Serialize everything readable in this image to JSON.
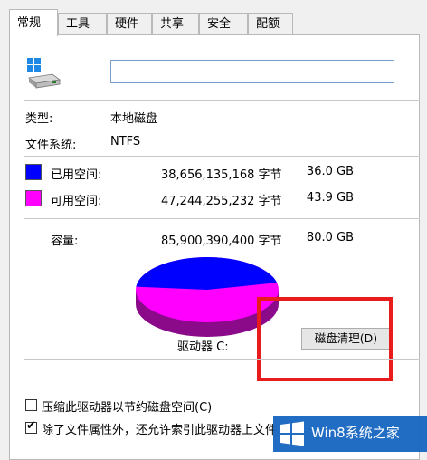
{
  "tabs": [
    {
      "label": "常规"
    },
    {
      "label": "工具"
    },
    {
      "label": "硬件"
    },
    {
      "label": "共享"
    },
    {
      "label": "安全"
    },
    {
      "label": "配额"
    }
  ],
  "volume_name_value": "",
  "rows": {
    "type_label": "类型:",
    "type_value": "本地磁盘",
    "fs_label": "文件系统:",
    "fs_value": "NTFS",
    "used_label": "已用空间:",
    "used_bytes": "38,656,135,168 字节",
    "used_gb": "36.0 GB",
    "free_label": "可用空间:",
    "free_bytes": "47,244,255,232 字节",
    "free_gb": "43.9 GB",
    "capacity_label": "容量:",
    "capacity_bytes": "85,900,390,400 字节",
    "capacity_gb": "80.0 GB"
  },
  "drive_label": "驱动器 C:",
  "cleanup_button": "磁盘清理(D)",
  "checkboxes": [
    {
      "label": "压缩此驱动器以节约磁盘空间(C)",
      "checked": false
    },
    {
      "label": "除了文件属性外，还允许索引此驱动器上文件",
      "checked": true
    }
  ],
  "colors": {
    "used": "#0000ff",
    "free": "#ff00ff",
    "highlight": "#e81c1c"
  },
  "pie": {
    "used_fraction": 0.45
  },
  "watermark": {
    "text": "Win8系统之家"
  }
}
